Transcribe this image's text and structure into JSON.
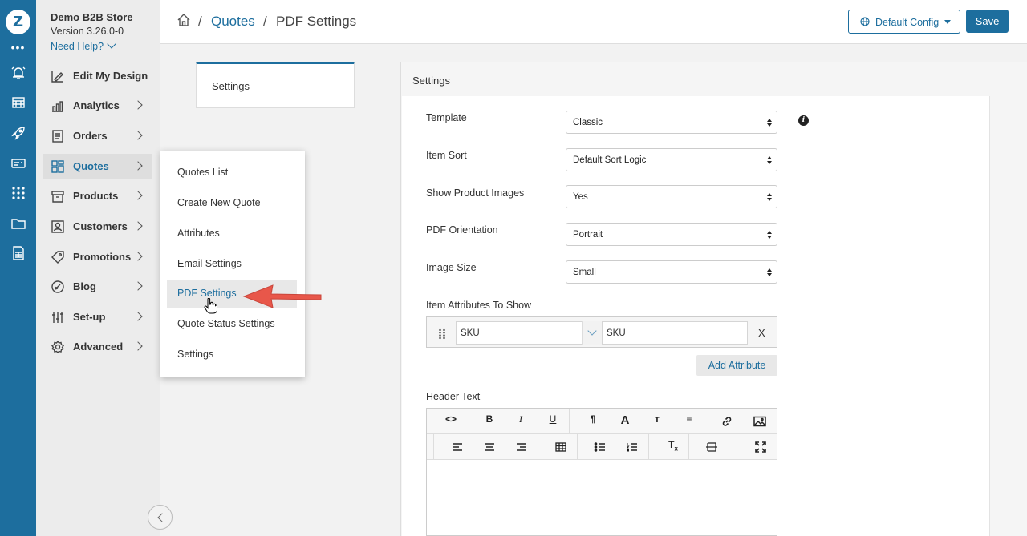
{
  "rail": {
    "logo": "Z",
    "icons": [
      "more-dots-icon",
      "alarm-icon",
      "store-icon",
      "rocket-icon",
      "card-icon",
      "apps-grid-icon",
      "folder-icon",
      "spreadsheet-icon"
    ]
  },
  "sidebar": {
    "store_name": "Demo B2B Store",
    "version": "Version 3.26.0-0",
    "help": "Need Help?",
    "items": [
      {
        "label": "Edit My Design",
        "icon": "design-icon"
      },
      {
        "label": "Analytics",
        "icon": "analytics-icon"
      },
      {
        "label": "Orders",
        "icon": "orders-icon"
      },
      {
        "label": "Quotes",
        "icon": "quotes-icon"
      },
      {
        "label": "Products",
        "icon": "products-icon"
      },
      {
        "label": "Customers",
        "icon": "customers-icon"
      },
      {
        "label": "Promotions",
        "icon": "promotions-icon"
      },
      {
        "label": "Blog",
        "icon": "blog-icon"
      },
      {
        "label": "Set-up",
        "icon": "setup-icon"
      },
      {
        "label": "Advanced",
        "icon": "advanced-gear-icon"
      }
    ]
  },
  "flyout": {
    "items": [
      "Quotes List",
      "Create New Quote",
      "Attributes",
      "Email Settings",
      "PDF Settings",
      "Quote Status Settings",
      "Settings"
    ]
  },
  "header": {
    "breadcrumb_sep": "/",
    "breadcrumb_parent": "Quotes",
    "breadcrumb_current": "PDF Settings",
    "config_label": "Default Config",
    "save_label": "Save"
  },
  "tab": {
    "label": "Settings"
  },
  "panel": {
    "title": "Settings",
    "fields": [
      {
        "label": "Template",
        "value": "Classic"
      },
      {
        "label": "Item Sort",
        "value": "Default Sort Logic"
      },
      {
        "label": "Show Product Images",
        "value": "Yes"
      },
      {
        "label": "PDF Orientation",
        "value": "Portrait"
      },
      {
        "label": "Image Size",
        "value": "Small"
      }
    ],
    "attributes_label": "Item Attributes To Show",
    "attribute_select": "SKU",
    "attribute_input": "SKU",
    "remove_label": "X",
    "add_attribute": "Add Attribute",
    "header_text_label": "Header Text",
    "toolbar_row1": [
      "<>",
      "B",
      "I",
      "U",
      "¶",
      "A",
      "TT",
      "≡",
      "link",
      "image"
    ],
    "toolbar_row2": [
      "align-left",
      "align-center",
      "align-right",
      "table",
      "bullet-list",
      "number-list",
      "Tx",
      "hr",
      "fullscreen"
    ]
  },
  "colors": {
    "brand": "#1d6e9e",
    "arrow": "#e8574a"
  }
}
